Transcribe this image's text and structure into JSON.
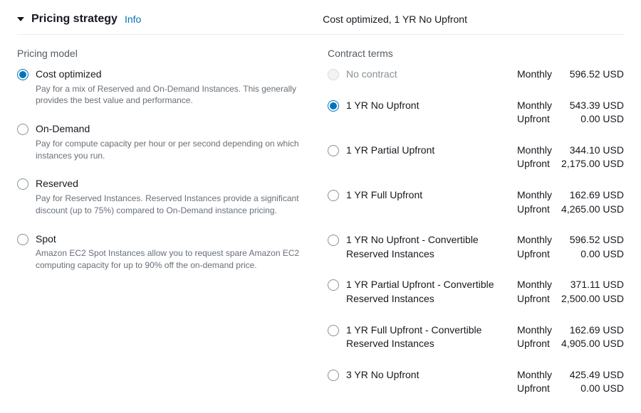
{
  "header": {
    "title": "Pricing strategy",
    "info": "Info",
    "summary": "Cost optimized, 1 YR No Upfront"
  },
  "pricingModel": {
    "title": "Pricing model",
    "options": [
      {
        "label": "Cost optimized",
        "desc": "Pay for a mix of Reserved and On-Demand Instances. This generally provides the best value and performance.",
        "selected": true
      },
      {
        "label": "On-Demand",
        "desc": "Pay for compute capacity per hour or per second depending on which instances you run.",
        "selected": false
      },
      {
        "label": "Reserved",
        "desc": "Pay for Reserved Instances. Reserved Instances provide a significant discount (up to 75%) compared to On-Demand instance pricing.",
        "selected": false
      },
      {
        "label": "Spot",
        "desc": "Amazon EC2 Spot Instances allow you to request spare Amazon EC2 computing capacity for up to 90% off the on-demand price.",
        "selected": false
      }
    ]
  },
  "contractTerms": {
    "title": "Contract terms",
    "monthlyLabel": "Monthly",
    "upfrontLabel": "Upfront",
    "options": [
      {
        "label": "No contract",
        "disabled": true,
        "selected": false,
        "monthly": "596.52 USD",
        "upfront": null
      },
      {
        "label": "1 YR No Upfront",
        "disabled": false,
        "selected": true,
        "monthly": "543.39 USD",
        "upfront": "0.00 USD"
      },
      {
        "label": "1 YR Partial Upfront",
        "disabled": false,
        "selected": false,
        "monthly": "344.10 USD",
        "upfront": "2,175.00 USD"
      },
      {
        "label": "1 YR Full Upfront",
        "disabled": false,
        "selected": false,
        "monthly": "162.69 USD",
        "upfront": "4,265.00 USD"
      },
      {
        "label": "1 YR No Upfront - Convertible Reserved Instances",
        "disabled": false,
        "selected": false,
        "monthly": "596.52 USD",
        "upfront": "0.00 USD"
      },
      {
        "label": "1 YR Partial Upfront - Convertible Reserved Instances",
        "disabled": false,
        "selected": false,
        "monthly": "371.11 USD",
        "upfront": "2,500.00 USD"
      },
      {
        "label": "1 YR Full Upfront - Convertible Reserved Instances",
        "disabled": false,
        "selected": false,
        "monthly": "162.69 USD",
        "upfront": "4,905.00 USD"
      },
      {
        "label": "3 YR No Upfront",
        "disabled": false,
        "selected": false,
        "monthly": "425.49 USD",
        "upfront": "0.00 USD"
      }
    ]
  }
}
